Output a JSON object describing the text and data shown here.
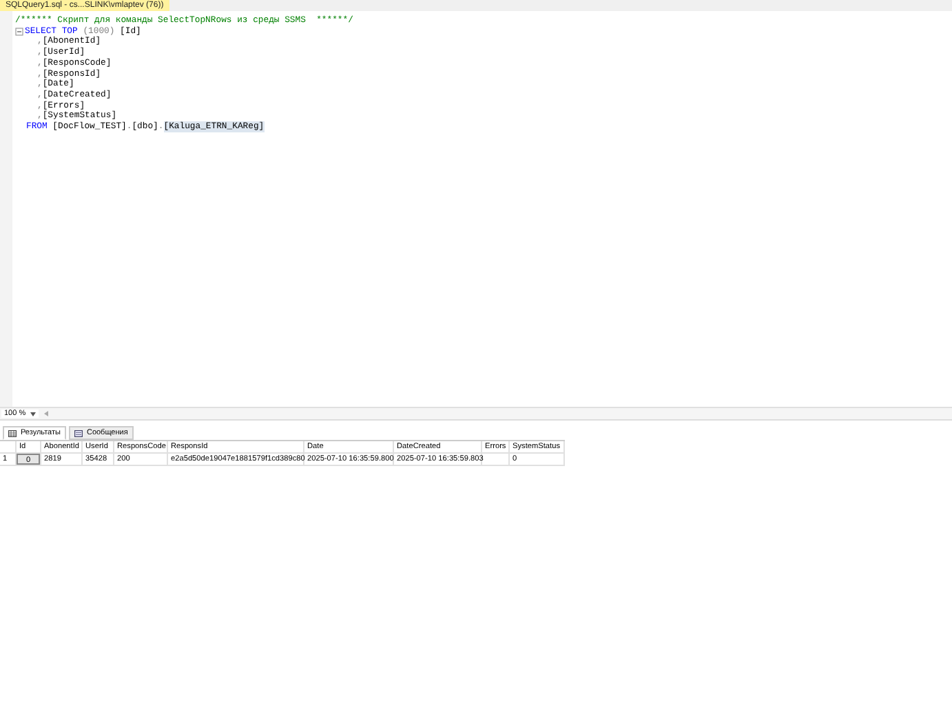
{
  "document_tab": {
    "title": "SQLQuery1.sql - cs...SLINK\\vmlaptev (76))",
    "selected": true
  },
  "editor": {
    "lines": [
      {
        "kind": "comment",
        "segments": [
          {
            "kind": "comment",
            "text": "/****** Скрипт для команды SelectTopNRows из среды SSMS  ******/"
          }
        ]
      },
      {
        "kind": "statement",
        "segments": [
          {
            "kind": "keyword",
            "text": "SELECT TOP"
          },
          {
            "kind": "gray",
            "text": " (1000)"
          },
          {
            "kind": "plain",
            "text": " [Id]"
          }
        ]
      },
      {
        "kind": "column",
        "segments": [
          {
            "kind": "gray",
            "text": ","
          },
          {
            "kind": "plain",
            "text": "[AbonentId]"
          }
        ]
      },
      {
        "kind": "column",
        "segments": [
          {
            "kind": "gray",
            "text": ","
          },
          {
            "kind": "plain",
            "text": "[UserId]"
          }
        ]
      },
      {
        "kind": "column",
        "segments": [
          {
            "kind": "gray",
            "text": ","
          },
          {
            "kind": "plain",
            "text": "[ResponsCode]"
          }
        ]
      },
      {
        "kind": "column",
        "segments": [
          {
            "kind": "gray",
            "text": ","
          },
          {
            "kind": "plain",
            "text": "[ResponsId]"
          }
        ]
      },
      {
        "kind": "column",
        "segments": [
          {
            "kind": "gray",
            "text": ","
          },
          {
            "kind": "plain",
            "text": "[Date]"
          }
        ]
      },
      {
        "kind": "column",
        "segments": [
          {
            "kind": "gray",
            "text": ","
          },
          {
            "kind": "plain",
            "text": "[DateCreated]"
          }
        ]
      },
      {
        "kind": "column",
        "segments": [
          {
            "kind": "gray",
            "text": ","
          },
          {
            "kind": "plain",
            "text": "[Errors]"
          }
        ]
      },
      {
        "kind": "column",
        "segments": [
          {
            "kind": "gray",
            "text": ","
          },
          {
            "kind": "plain",
            "text": "[SystemStatus]"
          }
        ]
      },
      {
        "kind": "clause",
        "segments": [
          {
            "kind": "keyword",
            "text": "FROM"
          },
          {
            "kind": "plain",
            "text": " [DocFlow_TEST]"
          },
          {
            "kind": "gray",
            "text": "."
          },
          {
            "kind": "plain",
            "text": "[dbo]"
          },
          {
            "kind": "gray",
            "text": "."
          },
          {
            "kind": "highlight",
            "text": "[Kaluga_ETRN_KAReg]"
          }
        ]
      }
    ]
  },
  "zoom": {
    "value": "100 %"
  },
  "result_tabs": [
    {
      "label": "Результаты",
      "selected": true
    },
    {
      "label": "Сообщения",
      "selected": false
    }
  ],
  "grid": {
    "columns": [
      "Id",
      "AbonentId",
      "UserId",
      "ResponsCode",
      "ResponsId",
      "Date",
      "DateCreated",
      "Errors",
      "SystemStatus"
    ],
    "rows": [
      {
        "number": "1",
        "cells": [
          "0",
          "2819",
          "35428",
          "200",
          "e2a5d50de19047e1881579f1cd389c80",
          "2025-07-10 16:35:59.800",
          "2025-07-10 16:35:59.803",
          "",
          "0"
        ]
      }
    ]
  }
}
